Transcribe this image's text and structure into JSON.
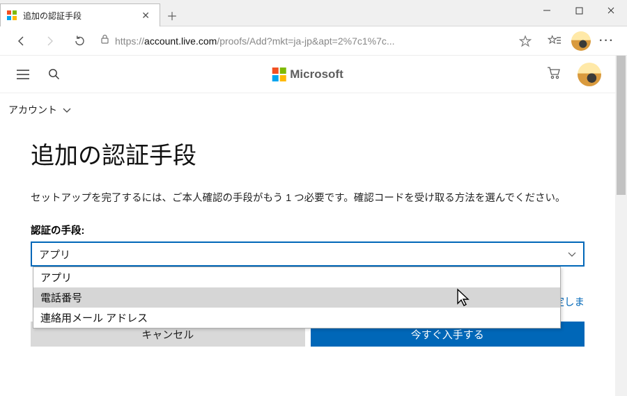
{
  "browser": {
    "tab_title": "追加の認証手段",
    "url_prefix": "https://",
    "url_host": "account.live.com",
    "url_path": "/proofs/Add?mkt=ja-jp&apt=2%7c1%7c...",
    "window_controls": {
      "min": "—",
      "max": "▢",
      "close": "✕"
    }
  },
  "page_header": {
    "brand": "Microsoft",
    "breadcrumb": "アカウント"
  },
  "content": {
    "title": "追加の認証手段",
    "description": "セットアップを完了するには、ご本人確認の手段がもう 1 つ必要です。確認コードを受け取る方法を選んでください。",
    "select_label": "認証の手段:",
    "select_value": "アプリ",
    "options": [
      "アプリ",
      "電話番号",
      "連絡用メール アドレス"
    ],
    "help_link": "証アプリを設定しま",
    "cancel": "キャンセル",
    "submit": "今すぐ入手する"
  }
}
